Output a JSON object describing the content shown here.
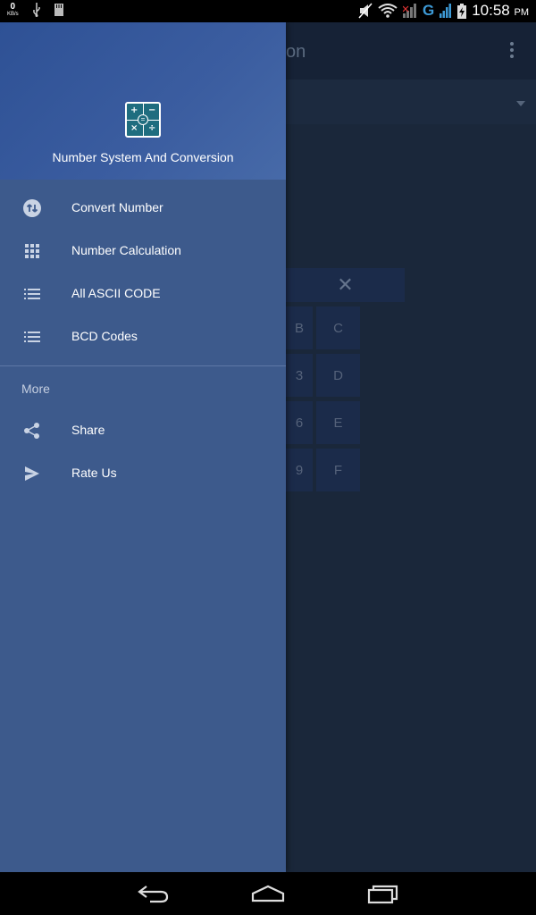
{
  "status_bar": {
    "net_speed_value": "0",
    "net_speed_unit": "KB/s",
    "network_type": "G",
    "time": "10:58",
    "ampm": "PM"
  },
  "background_app": {
    "title_fragment": "on",
    "keypad_keys": [
      "B",
      "C",
      "3",
      "D",
      "6",
      "E",
      "9",
      "F"
    ],
    "clear_key": "✕"
  },
  "drawer": {
    "header_title": "Number System And Conversion",
    "items": [
      {
        "label": "Convert Number",
        "icon": "swap-vert-icon"
      },
      {
        "label": "Number Calculation",
        "icon": "grid-icon"
      },
      {
        "label": "All ASCII CODE",
        "icon": "list-icon"
      },
      {
        "label": "BCD Codes",
        "icon": "list-icon"
      }
    ],
    "more_section": {
      "label": "More",
      "items": [
        {
          "label": "Share",
          "icon": "share-icon"
        },
        {
          "label": "Rate Us",
          "icon": "send-icon"
        }
      ]
    }
  },
  "colors": {
    "drawer_bg": "#3d5a8c",
    "header_bg": "#2e5195",
    "app_bg": "#1a273a"
  }
}
